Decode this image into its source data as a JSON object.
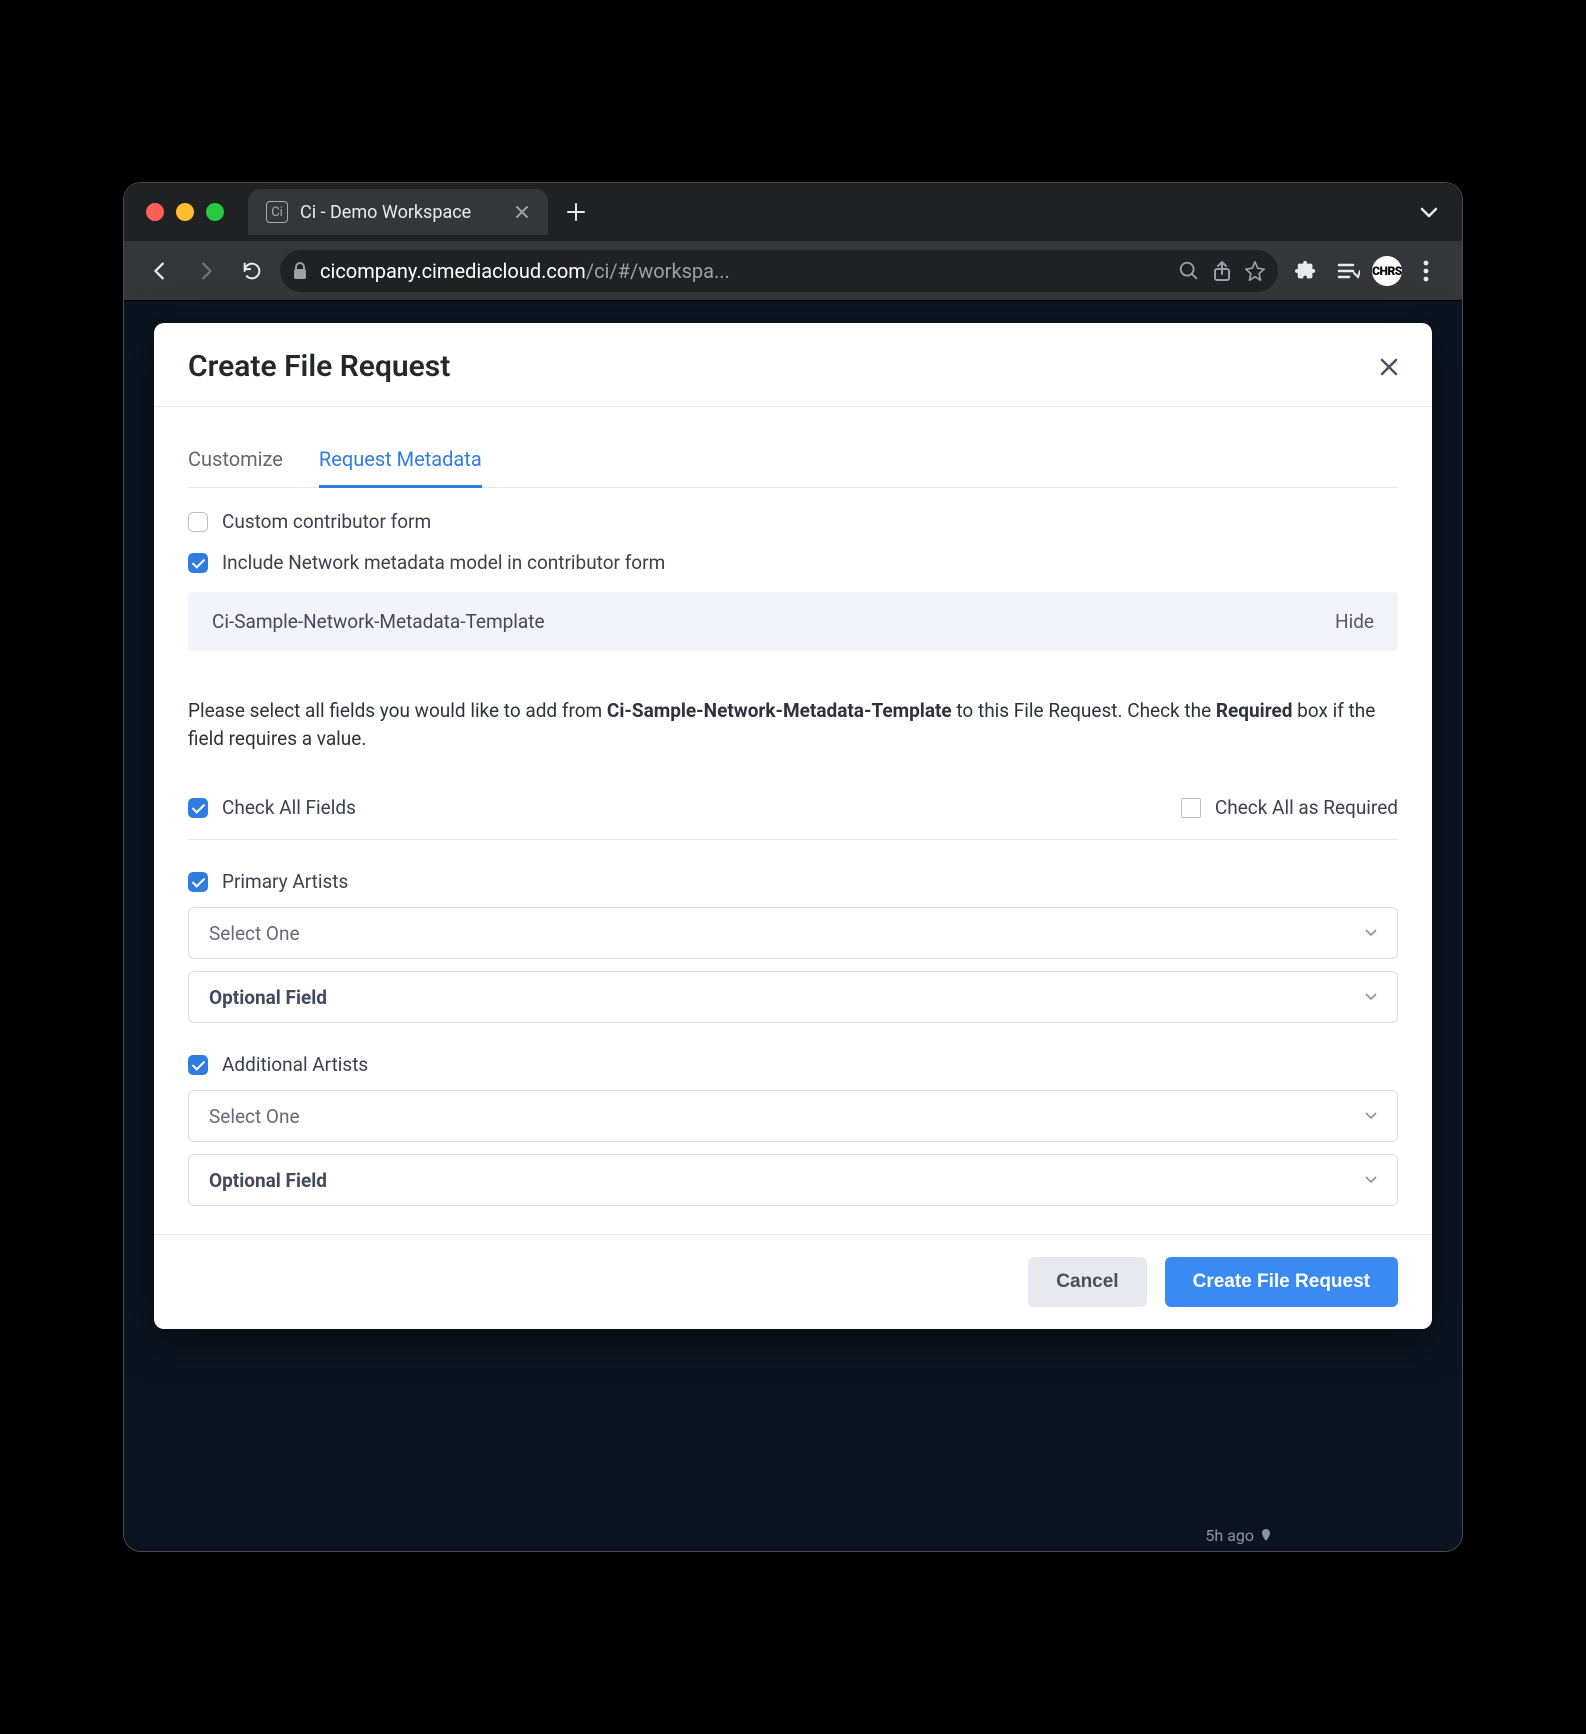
{
  "browser": {
    "tab_title": "Ci - Demo Workspace",
    "url_host": "cicompany.cimediacloud.com",
    "url_path": "/ci/#/workspa...",
    "avatar_initials": "CHRS"
  },
  "modal": {
    "title": "Create File Request",
    "tabs": {
      "customize": "Customize",
      "request_metadata": "Request Metadata"
    },
    "custom_form_label": "Custom contributor form",
    "include_network_label": "Include Network metadata model in contributor form",
    "template_name": "Ci-Sample-Network-Metadata-Template",
    "hide_label": "Hide",
    "instruction_prefix": "Please select all fields you would like to add from ",
    "instruction_template": "Ci-Sample-Network-Metadata-Template",
    "instruction_mid": " to this File Request. Check the ",
    "instruction_required": "Required",
    "instruction_suffix": " box if the field requires a value.",
    "check_all_fields": "Check All Fields",
    "check_all_required": "Check All as Required",
    "fields": [
      {
        "label": "Primary Artists",
        "select_placeholder": "Select One",
        "optional_label": "Optional Field"
      },
      {
        "label": "Additional Artists",
        "select_placeholder": "Select One",
        "optional_label": "Optional Field"
      }
    ],
    "cancel": "Cancel",
    "submit": "Create File Request"
  },
  "bottom_peek": "5h ago"
}
